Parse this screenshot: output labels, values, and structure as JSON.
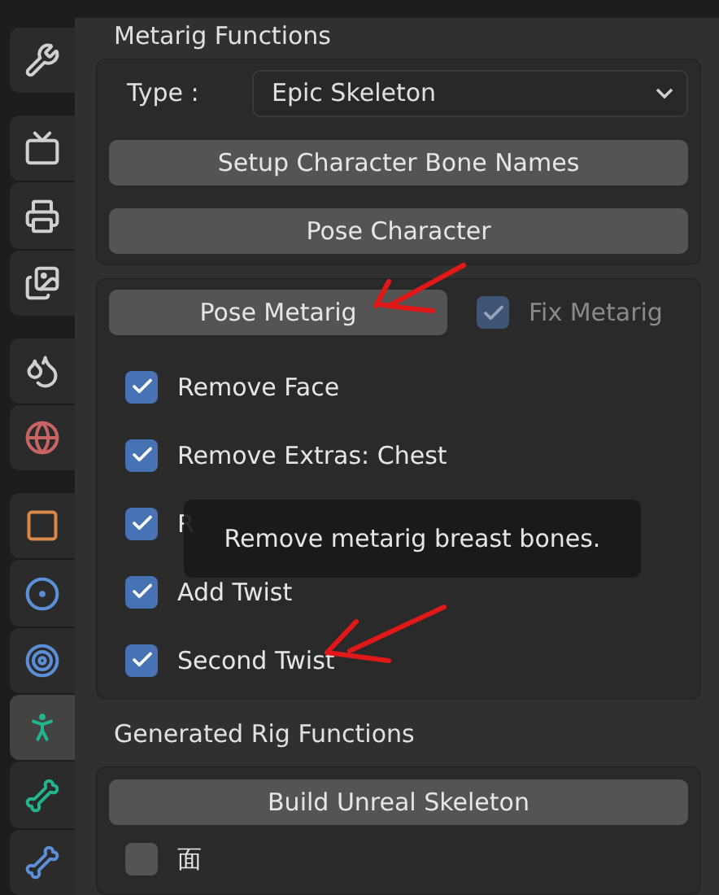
{
  "sidebar": {
    "tabs": [
      {
        "selected": false
      },
      {
        "selected": false
      },
      {
        "selected": false
      },
      {
        "selected": false
      },
      {
        "selected": false
      },
      {
        "selected": false
      },
      {
        "selected": false
      },
      {
        "selected": false
      },
      {
        "selected": false
      },
      {
        "selected": true
      },
      {
        "selected": false
      },
      {
        "selected": false
      }
    ]
  },
  "metarig": {
    "title": "Metarig Functions",
    "type_label": "Type :",
    "type_value": "Epic Skeleton",
    "buttons": [
      "Setup Character Bone Names",
      "Pose Character"
    ],
    "pose_button": "Pose Metarig",
    "fix": {
      "label": "Fix Metarig",
      "checked": true,
      "disabled": true
    },
    "options": [
      {
        "label": "Remove Face",
        "checked": true
      },
      {
        "label": "Remove Extras: Chest",
        "checked": true
      },
      {
        "label": "R",
        "checked": true
      },
      {
        "label": "Add Twist",
        "checked": true
      },
      {
        "label": "Second Twist",
        "checked": true
      }
    ],
    "tooltip": "Remove metarig breast bones."
  },
  "generated": {
    "title": "Generated Rig Functions",
    "button": "Build Unreal Skeleton",
    "options": [
      {
        "label": "面",
        "checked": false
      }
    ]
  }
}
